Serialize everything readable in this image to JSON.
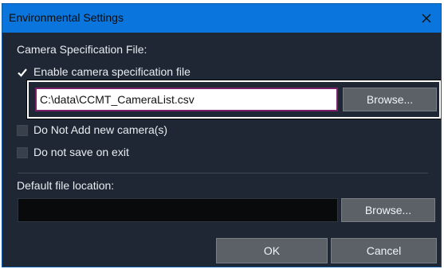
{
  "window": {
    "title": "Environmental Settings",
    "close_glyph": "✕",
    "close_icon": "close-icon"
  },
  "camera_spec": {
    "section_label": "Camera Specification File:",
    "enable_label": "Enable camera specification file",
    "enable_checked": true,
    "path_value": "C:\\data\\CCMT_CameraList.csv",
    "browse_label": "Browse..."
  },
  "options": {
    "do_not_add_label": "Do Not Add new camera(s)",
    "do_not_add_checked": false,
    "do_not_save_label": "Do not save on exit",
    "do_not_save_checked": false
  },
  "default_location": {
    "section_label": "Default file location:",
    "path_value": "",
    "browse_label": "Browse..."
  },
  "footer": {
    "ok_label": "OK",
    "cancel_label": "Cancel"
  },
  "colors": {
    "titlebar": "#0a76dd",
    "dialog_bg": "#1e2733",
    "accent_check": "#ffffff",
    "input_border_focus": "#7a1f6a"
  }
}
